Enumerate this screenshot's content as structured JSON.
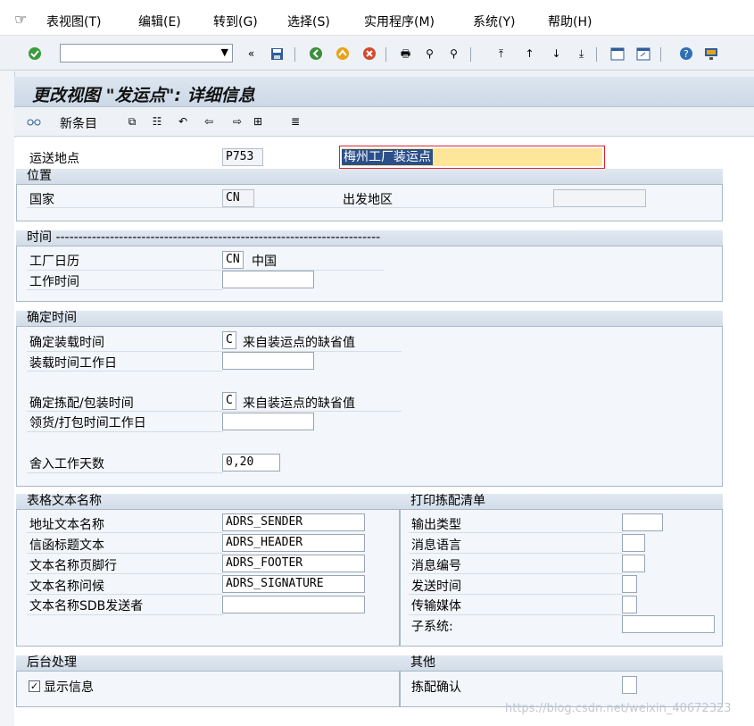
{
  "menubar": {
    "items": [
      "表视图(T)",
      "编辑(E)",
      "转到(G)",
      "选择(S)",
      "实用程序(M)",
      "系统(Y)",
      "帮助(H)"
    ]
  },
  "toolbar": {
    "command_value": "",
    "icons": [
      "check-icon",
      "back-icon",
      "save-icon",
      "green-arrow-icon",
      "up-arrow-icon",
      "cancel-icon",
      "print-icon",
      "find-icon",
      "find-next-icon",
      "first-page-icon",
      "prev-page-icon",
      "next-page-icon",
      "last-page-icon",
      "new-session-icon",
      "shortcut-icon",
      "help-icon",
      "monitor-icon"
    ]
  },
  "title": "更改视图 \"发运点\": 详细信息",
  "app_toolbar": {
    "new_entry_label": "新条目"
  },
  "form": {
    "shipping_point_label": "运送地点",
    "shipping_point_value": "P753",
    "shipping_point_desc": "梅州工厂装运点",
    "location": {
      "header": "位置",
      "country_label": "国家",
      "country_value": "CN",
      "departure_zone_label": "出发地区",
      "departure_zone_value": ""
    },
    "time": {
      "header": "时间 ------------------------------------------------------------------------",
      "factory_calendar_label": "工厂日历",
      "factory_calendar_value": "CN",
      "factory_calendar_text": "中国",
      "working_time_label": "工作时间",
      "working_time_value": ""
    },
    "determine_time": {
      "header": "确定时间",
      "loading_time_label": "确定装载时间",
      "loading_time_value": "C",
      "loading_time_text": "来自装运点的缺省值",
      "loading_workdays_label": "装载时间工作日",
      "loading_workdays_value": "",
      "picking_time_label": "确定拣配/包装时间",
      "picking_time_value": "C",
      "picking_time_text": "来自装运点的缺省值",
      "picking_workdays_label": "领货/打包时间工作日",
      "picking_workdays_value": "",
      "rounding_label": "舍入工作天数",
      "rounding_value": "0,20"
    },
    "form_texts": {
      "header": "表格文本名称",
      "address_label": "地址文本名称",
      "address_value": "ADRS_SENDER",
      "letter_header_label": "信函标题文本",
      "letter_header_value": "ADRS_HEADER",
      "footer_label": "文本名称页脚行",
      "footer_value": "ADRS_FOOTER",
      "greeting_label": "文本名称问候",
      "greeting_value": "ADRS_SIGNATURE",
      "sdb_label": "文本名称SDB发送者",
      "sdb_value": ""
    },
    "print_picking": {
      "header": "打印拣配清单",
      "output_type_label": "输出类型",
      "message_language_label": "消息语言",
      "message_number_label": "消息编号",
      "send_time_label": "发送时间",
      "transmission_label": "传输媒体",
      "subsystem_label": "子系统:"
    },
    "background": {
      "header": "后台处理",
      "show_info_label": "显示信息",
      "show_info_checked": "✓"
    },
    "other": {
      "header": "其他",
      "picking_confirm_label": "拣配确认"
    }
  },
  "watermark": "https://blog.csdn.net/weixin_40672323"
}
